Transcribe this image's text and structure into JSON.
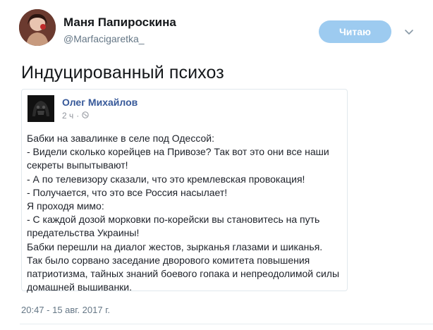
{
  "author": {
    "name": "Маня Папироскина",
    "handle": "@Marfacigaretka_"
  },
  "follow_button": {
    "label": "Читаю"
  },
  "tweet": {
    "text": "Индуцированный психоз"
  },
  "quoted_post": {
    "author": "Олег Михайлов",
    "time": "2 ч",
    "body_lines": [
      "Бабки на завалинке в селе под Одессой:",
      "- Видели сколько корейцев на Привозе? Так вот это они все наши",
      "секреты выпытывают!",
      "- А по телевизору сказали, что это кремлевская провокация!",
      "- Получается, что это все Россия насылает!",
      "Я проходя мимо:",
      "- С каждой дозой морковки по-корейски вы становитесь на путь",
      "предательства Украины!",
      "Бабки перешли на диалог жестов, зырканья глазами и шиканья.",
      "Так было сорвано заседание дворового комитета повышения",
      "патриотизма, тайных знаний боевого гопака и непреодолимой силы",
      "домашней вышиванки."
    ]
  },
  "timestamp": "20:47 - 15 авг. 2017 г.",
  "colors": {
    "follow_button_bg": "#9dcbf0",
    "quoted_author": "#365899",
    "muted_text": "#657786"
  }
}
